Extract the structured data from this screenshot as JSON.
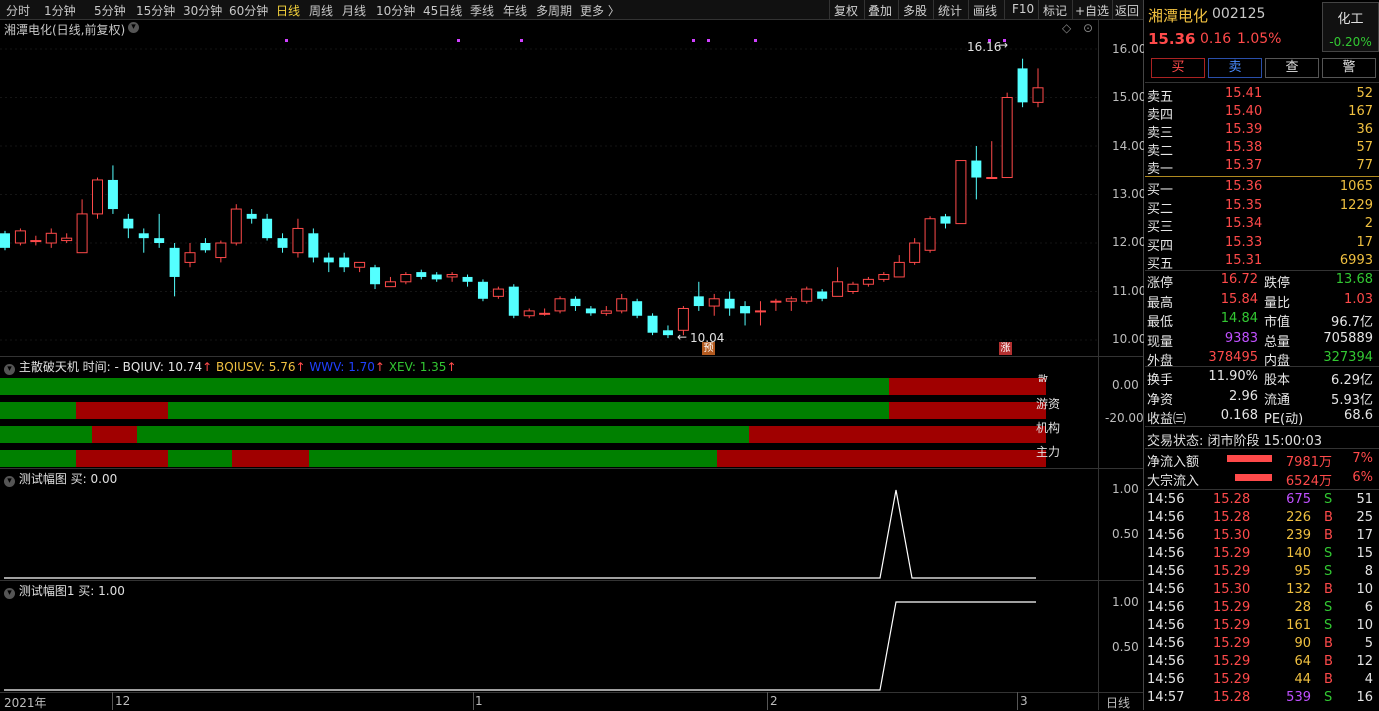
{
  "toolbar": {
    "periods": [
      "分时",
      "1分钟",
      "5分钟",
      "15分钟",
      "30分钟",
      "60分钟",
      "日线",
      "周线",
      "月线",
      "10分钟",
      "45日线",
      "季线",
      "年线",
      "多周期",
      "更多 〉"
    ],
    "selected": "日线",
    "right_buttons": [
      "复权",
      "叠加",
      "多股",
      "统计",
      "画线",
      "F10",
      "标记",
      "+自选",
      "返回"
    ]
  },
  "main_chart": {
    "title": "湘潭电化(日线,前复权)",
    "high_label": "16.16",
    "low_label": "10.04",
    "marker_yu": "预",
    "marker_zhang": "涨",
    "y_ticks": [
      "16.00",
      "15.00",
      "14.00",
      "13.00",
      "12.00",
      "11.00",
      "10.00"
    ]
  },
  "chart_data": {
    "type": "candlestick",
    "ylim": [
      9.8,
      16.6
    ],
    "y_ticks": [
      10,
      11,
      12,
      13,
      14,
      15,
      16
    ],
    "candles": [
      [
        12.2,
        11.9,
        12.25,
        11.85
      ],
      [
        12.0,
        12.25,
        12.3,
        11.95
      ],
      [
        12.05,
        12.05,
        12.15,
        11.95
      ],
      [
        12.0,
        12.2,
        12.3,
        11.9
      ],
      [
        12.05,
        12.1,
        12.2,
        12.0
      ],
      [
        11.8,
        12.6,
        12.9,
        11.8
      ],
      [
        12.6,
        13.3,
        13.35,
        12.5
      ],
      [
        13.3,
        12.7,
        13.6,
        12.6
      ],
      [
        12.5,
        12.3,
        12.6,
        12.1
      ],
      [
        12.2,
        12.1,
        12.3,
        11.8
      ],
      [
        12.1,
        12.0,
        12.6,
        11.9
      ],
      [
        11.9,
        11.3,
        12.0,
        10.9
      ],
      [
        11.6,
        11.8,
        12.0,
        11.5
      ],
      [
        12.0,
        11.85,
        12.1,
        11.8
      ],
      [
        11.7,
        12.0,
        12.05,
        11.6
      ],
      [
        12.0,
        12.7,
        12.8,
        11.95
      ],
      [
        12.6,
        12.5,
        12.7,
        12.4
      ],
      [
        12.5,
        12.1,
        12.6,
        12.05
      ],
      [
        12.1,
        11.9,
        12.2,
        11.8
      ],
      [
        11.8,
        12.3,
        12.5,
        11.7
      ],
      [
        12.2,
        11.7,
        12.3,
        11.6
      ],
      [
        11.7,
        11.6,
        11.8,
        11.4
      ],
      [
        11.7,
        11.5,
        11.8,
        11.4
      ],
      [
        11.5,
        11.6,
        11.6,
        11.4
      ],
      [
        11.5,
        11.15,
        11.55,
        11.05
      ],
      [
        11.1,
        11.2,
        11.3,
        11.1
      ],
      [
        11.2,
        11.35,
        11.4,
        11.15
      ],
      [
        11.4,
        11.3,
        11.45,
        11.25
      ],
      [
        11.35,
        11.25,
        11.4,
        11.2
      ],
      [
        11.3,
        11.35,
        11.4,
        11.2
      ],
      [
        11.3,
        11.2,
        11.35,
        11.1
      ],
      [
        11.2,
        10.85,
        11.25,
        10.8
      ],
      [
        10.9,
        11.05,
        11.1,
        10.85
      ],
      [
        11.1,
        10.5,
        11.15,
        10.45
      ],
      [
        10.5,
        10.6,
        10.65,
        10.45
      ],
      [
        10.55,
        10.55,
        10.65,
        10.5
      ],
      [
        10.6,
        10.85,
        10.9,
        10.55
      ],
      [
        10.85,
        10.7,
        10.9,
        10.6
      ],
      [
        10.65,
        10.55,
        10.7,
        10.5
      ],
      [
        10.55,
        10.6,
        10.7,
        10.5
      ],
      [
        10.6,
        10.85,
        10.95,
        10.55
      ],
      [
        10.8,
        10.5,
        10.85,
        10.45
      ],
      [
        10.5,
        10.15,
        10.55,
        10.1
      ],
      [
        10.2,
        10.1,
        10.3,
        10.04
      ],
      [
        10.2,
        10.65,
        10.7,
        10.1
      ],
      [
        10.9,
        10.7,
        11.2,
        10.6
      ],
      [
        10.7,
        10.85,
        10.95,
        10.5
      ],
      [
        10.85,
        10.65,
        11.0,
        10.5
      ],
      [
        10.7,
        10.55,
        10.8,
        10.3
      ],
      [
        10.6,
        10.6,
        10.8,
        10.3
      ],
      [
        10.8,
        10.8,
        10.85,
        10.6
      ],
      [
        10.8,
        10.85,
        10.9,
        10.6
      ],
      [
        10.8,
        11.05,
        11.1,
        10.75
      ],
      [
        11.0,
        10.85,
        11.05,
        10.8
      ],
      [
        10.9,
        11.2,
        11.5,
        10.9
      ],
      [
        11.0,
        11.15,
        11.2,
        10.95
      ],
      [
        11.15,
        11.25,
        11.3,
        11.1
      ],
      [
        11.25,
        11.35,
        11.4,
        11.2
      ],
      [
        11.3,
        11.6,
        11.75,
        11.3
      ],
      [
        11.6,
        12.0,
        12.1,
        11.55
      ],
      [
        11.85,
        12.5,
        12.55,
        11.8
      ],
      [
        12.55,
        12.4,
        12.6,
        12.3
      ],
      [
        12.4,
        13.7,
        13.7,
        12.4
      ],
      [
        13.7,
        13.35,
        14.0,
        12.9
      ],
      [
        13.35,
        13.35,
        14.1,
        13.35
      ],
      [
        13.35,
        15.0,
        15.1,
        13.35
      ],
      [
        15.6,
        14.9,
        15.8,
        14.8
      ],
      [
        14.9,
        15.2,
        15.6,
        14.8
      ]
    ]
  },
  "indicator1": {
    "title": "主散破天机 时间: -",
    "items": [
      {
        "label": "BQIUV:",
        "value": "10.74",
        "color": "#e6e6e6"
      },
      {
        "label": "BQIUSV:",
        "value": "5.76",
        "color": "#f0c040"
      },
      {
        "label": "WWV:",
        "value": "1.70",
        "color": "#2040ff"
      },
      {
        "label": "XEV:",
        "value": "1.35",
        "color": "#32c832"
      }
    ],
    "rows": [
      "散",
      "游资",
      "机构",
      "主力"
    ],
    "y_ticks": [
      "0.00",
      "-20.00"
    ]
  },
  "indicator2": {
    "title": "测试幅图",
    "buy_label": "买:",
    "buy_value": "0.00",
    "y_ticks": [
      "1.00",
      "0.50"
    ]
  },
  "indicator3": {
    "title": "测试幅图1",
    "buy_label": "买:",
    "buy_value": "1.00",
    "y_ticks": [
      "1.00",
      "0.50"
    ]
  },
  "time_axis": {
    "labels": [
      "2021年",
      "12",
      "1",
      "2",
      "3"
    ],
    "period": "日线"
  },
  "quote": {
    "name": "湘潭电化",
    "code": "002125",
    "industry": "化工",
    "industry_change": "-0.20%",
    "price": "15.36",
    "change": "0.16",
    "change_pct": "1.05%",
    "buttons": [
      "买",
      "卖",
      "查",
      "警"
    ],
    "asks": [
      {
        "label": "卖五",
        "price": "15.41",
        "vol": "52"
      },
      {
        "label": "卖四",
        "price": "15.40",
        "vol": "167"
      },
      {
        "label": "卖三",
        "price": "15.39",
        "vol": "36"
      },
      {
        "label": "卖二",
        "price": "15.38",
        "vol": "57"
      },
      {
        "label": "卖一",
        "price": "15.37",
        "vol": "77"
      }
    ],
    "bids": [
      {
        "label": "买一",
        "price": "15.36",
        "vol": "1065"
      },
      {
        "label": "买二",
        "price": "15.35",
        "vol": "1229"
      },
      {
        "label": "买三",
        "price": "15.34",
        "vol": "2"
      },
      {
        "label": "买四",
        "price": "15.33",
        "vol": "17"
      },
      {
        "label": "买五",
        "price": "15.31",
        "vol": "6993"
      }
    ],
    "stats1": [
      {
        "k1": "涨停",
        "v1": "16.72",
        "c1": "red",
        "k2": "跌停",
        "v2": "13.68",
        "c2": "green"
      },
      {
        "k1": "最高",
        "v1": "15.84",
        "c1": "red",
        "k2": "量比",
        "v2": "1.03",
        "c2": "red"
      },
      {
        "k1": "最低",
        "v1": "14.84",
        "c1": "green",
        "k2": "市值",
        "v2": "96.7亿",
        "c2": "white"
      },
      {
        "k1": "现量",
        "v1": "9383",
        "c1": "purple",
        "k2": "总量",
        "v2": "705889",
        "c2": "white"
      },
      {
        "k1": "外盘",
        "v1": "378495",
        "c1": "red",
        "k2": "内盘",
        "v2": "327394",
        "c2": "green"
      }
    ],
    "stats2": [
      {
        "k1": "换手",
        "v1": "11.90%",
        "c1": "white",
        "k2": "股本",
        "v2": "6.29亿",
        "c2": "white"
      },
      {
        "k1": "净资",
        "v1": "2.96",
        "c1": "white",
        "k2": "流通",
        "v2": "5.93亿",
        "c2": "white"
      },
      {
        "k1": "收益㈢",
        "v1": "0.168",
        "c1": "white",
        "k2": "PE(动)",
        "v2": "68.6",
        "c2": "white"
      }
    ],
    "status_label": "交易状态: 闭市阶段 15:00:03",
    "flows": [
      {
        "label": "净流入额",
        "amount": "7981万",
        "pct": "7%"
      },
      {
        "label": "大宗流入",
        "amount": "6524万",
        "pct": "6%"
      }
    ],
    "ticks": [
      {
        "t": "14:56",
        "p": "15.28",
        "v": "675",
        "vc": "purple",
        "s": "S",
        "n": "51"
      },
      {
        "t": "14:56",
        "p": "15.28",
        "v": "226",
        "vc": "yellow",
        "s": "B",
        "n": "25"
      },
      {
        "t": "14:56",
        "p": "15.30",
        "v": "239",
        "vc": "yellow",
        "s": "B",
        "n": "17"
      },
      {
        "t": "14:56",
        "p": "15.29",
        "v": "140",
        "vc": "yellow",
        "s": "S",
        "n": "15"
      },
      {
        "t": "14:56",
        "p": "15.29",
        "v": "95",
        "vc": "yellow",
        "s": "S",
        "n": "8"
      },
      {
        "t": "14:56",
        "p": "15.30",
        "v": "132",
        "vc": "yellow",
        "s": "B",
        "n": "10"
      },
      {
        "t": "14:56",
        "p": "15.29",
        "v": "28",
        "vc": "yellow",
        "s": "S",
        "n": "6"
      },
      {
        "t": "14:56",
        "p": "15.29",
        "v": "161",
        "vc": "yellow",
        "s": "S",
        "n": "10"
      },
      {
        "t": "14:56",
        "p": "15.29",
        "v": "90",
        "vc": "yellow",
        "s": "B",
        "n": "5"
      },
      {
        "t": "14:56",
        "p": "15.29",
        "v": "64",
        "vc": "yellow",
        "s": "B",
        "n": "12"
      },
      {
        "t": "14:56",
        "p": "15.29",
        "v": "44",
        "vc": "yellow",
        "s": "B",
        "n": "4"
      },
      {
        "t": "14:57",
        "p": "15.28",
        "v": "539",
        "vc": "purple",
        "s": "S",
        "n": "16"
      }
    ]
  }
}
